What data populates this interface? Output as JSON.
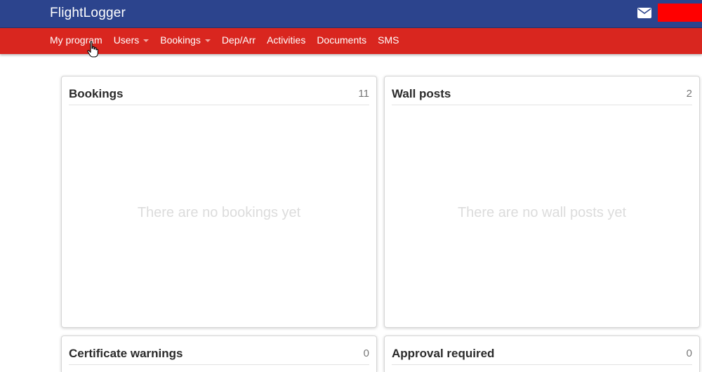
{
  "app": {
    "title": "FlightLogger"
  },
  "header": {
    "mail_icon": "envelope-icon",
    "user_badge_color": "#ff0000"
  },
  "nav": {
    "items": [
      {
        "label": "My program",
        "dropdown": false
      },
      {
        "label": "Users",
        "dropdown": true
      },
      {
        "label": "Bookings",
        "dropdown": true
      },
      {
        "label": "Dep/Arr",
        "dropdown": false
      },
      {
        "label": "Activities",
        "dropdown": false
      },
      {
        "label": "Documents",
        "dropdown": false
      },
      {
        "label": "SMS",
        "dropdown": false
      }
    ]
  },
  "panels": {
    "bookings": {
      "title": "Bookings",
      "count": "11",
      "empty_text": "There are no bookings yet"
    },
    "wall_posts": {
      "title": "Wall posts",
      "count": "2",
      "empty_text": "There are no wall posts yet"
    },
    "certificate_warnings": {
      "title": "Certificate warnings",
      "count": "0"
    },
    "approval_required": {
      "title": "Approval required",
      "count": "0"
    }
  },
  "colors": {
    "topbar": "#2c448d",
    "navbar": "#d9261f"
  }
}
